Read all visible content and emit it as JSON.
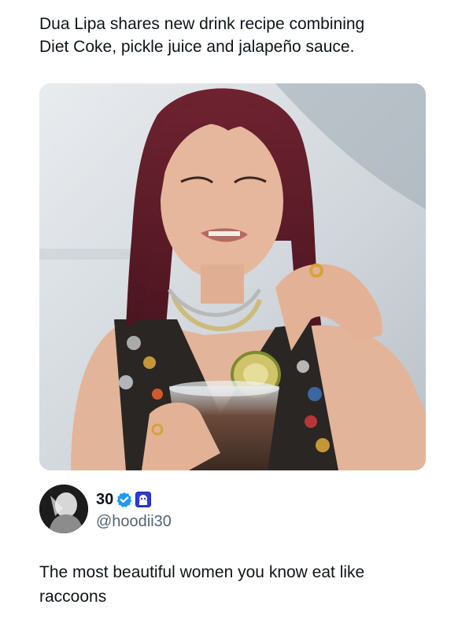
{
  "post": {
    "headline": "Dua Lipa shares new drink recipe combining\nDiet Coke, pickle juice and jalapeño sauce."
  },
  "author": {
    "display_name": "30",
    "handle": "@hoodii30",
    "verified_badge_color": "#1d9bf0",
    "affiliate_badge_color": "#2f3bd6"
  },
  "tweet": {
    "text": "The most beautiful women you know eat like raccoons"
  }
}
